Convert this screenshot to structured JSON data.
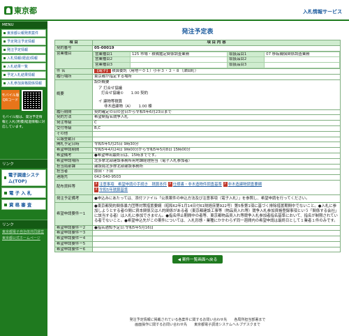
{
  "header": {
    "logo_text": "東京都",
    "right_label": "入札情報サービス"
  },
  "sidebar": {
    "section_top": "MENU",
    "items": [
      "東京都公報発表案件",
      "予定発注予定情報",
      "発注予定情報",
      "入札情報(経過)情報",
      "入札結果一覧",
      "予定入札結果情報",
      "入札参加資格関係情報"
    ],
    "mobile_label": "モバイル版 QRコード",
    "note": "モバイル版は、発注予定情報と入札(見積)経過情報に対応しています。",
    "section_link": "リンク",
    "big_items": [
      "電子調達システム(TOP)",
      "電 子 入 札",
      "資 格 審 査"
    ],
    "section_links2": "リンク",
    "links": [
      "東京都電子自治体共同運営",
      "東京都公式ホームページ"
    ]
  },
  "page": {
    "title": "発注予定表",
    "col_item": "項 目",
    "col_content": "項 目 内 容",
    "contract_no_label": "契約番号",
    "contract_no": "05-00019",
    "biz_label": "営業種目",
    "biz": [
      {
        "k": "営業種目1",
        "v": "125 市場・積備鑑定関係調査業務",
        "k2": "取扱品目1",
        "v2": "07 移転補償関係調査業務"
      },
      {
        "k": "営業種目2",
        "v": "",
        "k2": "取扱品目2",
        "v2": ""
      },
      {
        "k": "営業種目3",
        "v": "",
        "k2": "取扱品目3",
        "v2": ""
      }
    ],
    "name_label": "件 名",
    "name_tag": "【電子】",
    "name": "積算委託（用地ー０１）小平３・２・８（津田町）",
    "place_label": "履行場所",
    "place": "東京都が指定する場所",
    "summary_label": "概要",
    "summary_lines": [
      "設計概要",
      "ア 打合せ協議",
      "打合せ協議①　　1.00 契約",
      "",
      "イ 建物等積算",
      "非木造建物（A）　　1.00 棟"
    ],
    "rows": [
      {
        "l": "履行期間",
        "v": "契約確定の日の翌日から令和5年6月23日まで"
      },
      {
        "l": "契約方法",
        "v": "希望制指名競争入札"
      },
      {
        "l": "発注等級",
        "v": "C"
      },
      {
        "l": "受付等級",
        "v": "B,C"
      },
      {
        "l": "その他",
        "v": ""
      },
      {
        "l": "公報登載日",
        "v": ""
      },
      {
        "l": "開札予定日時",
        "v": "令和5年5月25日 9時30分"
      },
      {
        "l": "希望申請期間",
        "v": "令和5年4月24日 9時00分から令和5年5月8日 15時00分"
      },
      {
        "l": "希望備考",
        "v": "●希望申出最終日は、15時までです。"
      },
      {
        "l": "希望申請場所",
        "v": "北多摩北部建設事務所用地課経理担当（電子入札参加者）"
      },
      {
        "l": "担当局部課",
        "v": "建設局北多摩北部建設事務所"
      },
      {
        "l": "担当者",
        "v": "原田・下田"
      },
      {
        "l": "連絡先",
        "v": "042-540-9503"
      }
    ],
    "docs_label": "配布資料等",
    "docs": [
      "注意事項　希望申請の手続き　積算本件",
      "仕様書・非木造物件調査基準",
      "非木造建物調査要綱",
      "令和5年積算基準"
    ],
    "notes_label": "発注予定備考",
    "notes": "●申込みにあたっては、添付ファイル「公表案件の申込方法及び注意事項（電子入札）」を参照し、希望申請を行ってください。",
    "req1_label": "希望申請要件ー1",
    "req1": "●東京都契約関係暴力団等対策措置要綱（昭和62年1月14日付61財経庶第922号）第5条第1項に基づく排除措置期間中でないこと。●入札に参加しようとする者の間に資本関係又は人的関係がある者（東京都建設工事等（物品買入れ等）競争入札参加資格登録事項という「関係する会社」に該当する者）は入札に参加できません。●指名停止期間中の者等、東京都物品買入れ等競争入札参加者指名基準において、指名が制限されている者でないこと。●希望申込先がこの案件については、入札形態・業種にかかわらず同一週間内の希望申請は最終日として１業者１件のみです。",
    "req2_label": "希望申請要件ー2",
    "req2": "●指名通知予定日:令和5年5月16日",
    "req_more": [
      "希望申請要件ー3",
      "希望申請要件ー4",
      "希望申請要件ー5",
      "希望申請要件ー6"
    ],
    "back_button": "◀ 案件一覧画面へ戻る"
  },
  "footer": {
    "line1": "発注予定情報に掲載されている各案件に関するお問い合わせ先　　各局所担当部署まで",
    "line2": "画面操作に関するお問い合わせ先　　東京都電子調達システムヘルプデスクまで"
  }
}
